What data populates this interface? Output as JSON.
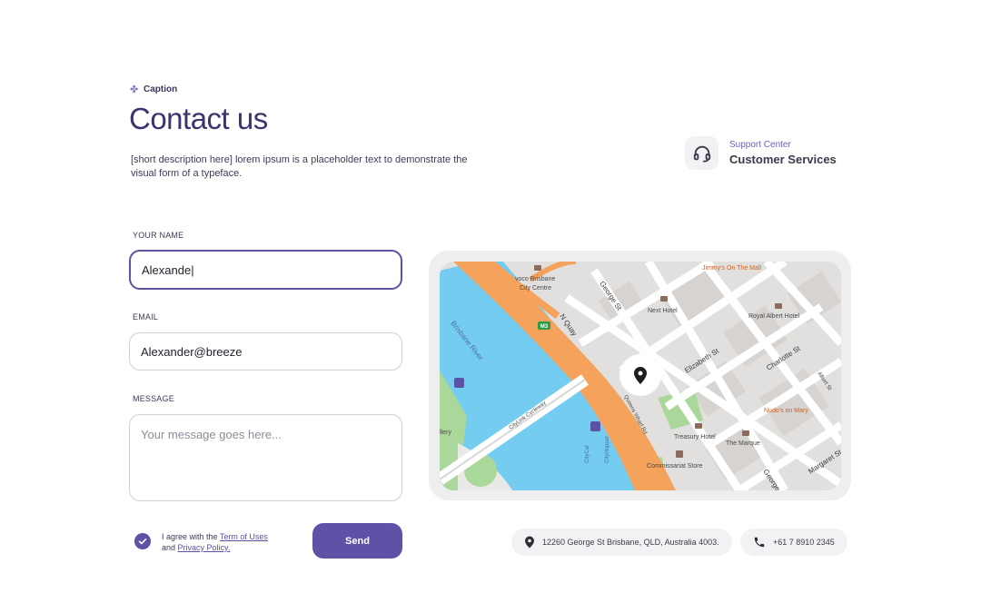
{
  "header": {
    "caption": "Caption",
    "title": "Contact us",
    "description": "[short description here] lorem ipsum is a placeholder text to demonstrate the visual form of a typeface."
  },
  "support": {
    "small": "Support Center",
    "big": "Customer Services",
    "icon": "headset-icon"
  },
  "form": {
    "name_label": "YOUR NAME",
    "name_value": "Alexande|",
    "email_label": "EMAIL",
    "email_value": "Alexander@breeze",
    "message_label": "MESSAGE",
    "message_placeholder": "Your message goes here...",
    "agree_prefix": "I agree with the",
    "terms_link": "Term of Uses",
    "and_text": "and",
    "privacy_link": "Privacy Policy.",
    "send_label": "Send"
  },
  "map": {
    "labels": {
      "voco": "voco Brisbane",
      "voco2": "City Centre",
      "jimmys": "Jimmy's On The Mall",
      "next_hotel": "Next Hotel",
      "royal": "Royal Albert Hotel",
      "river": "Brisbane River",
      "george": "George St",
      "nquay": "N Quay",
      "elizabeth": "Elizabeth St",
      "charlotte": "Charlotte St",
      "albert": "Albert St",
      "nudos": "Nudo's on Mary",
      "treasury": "Treasury Hotel",
      "marque": "The Marque",
      "commissariat": "Commissariat Store",
      "cyclelink": "CityLink Cycleway",
      "wharf": "Queens Wharf Rd",
      "margaret": "Margaret St",
      "george2": "George",
      "gallery": "llery",
      "m3": "M3",
      "citycat": "CityCat",
      "cityhopper": "CityHopper"
    },
    "colors": {
      "water": "#74cdf0",
      "highway": "#f5a35c",
      "land": "#e2e0de",
      "park": "#a9d89a",
      "accent": "#5b52a6"
    }
  },
  "contact": {
    "address": "12260 George St Brisbane, QLD, Australia 4003.",
    "phone": "+61 7 8910 2345"
  }
}
